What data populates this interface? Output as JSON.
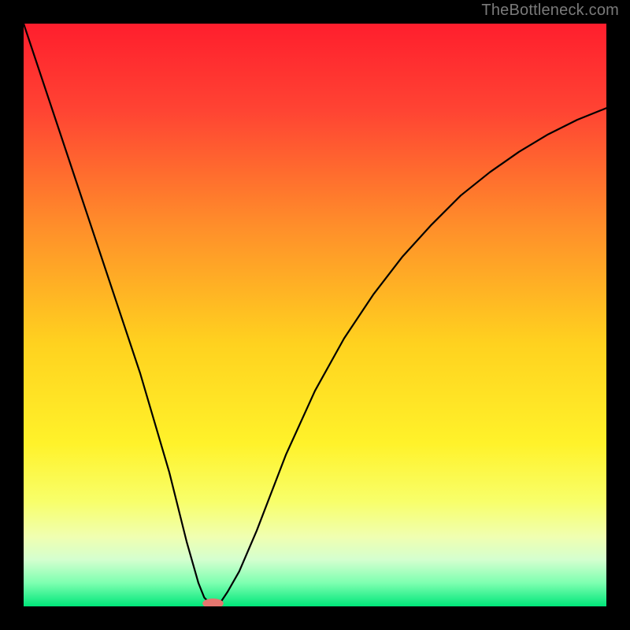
{
  "watermark": "TheBottleneck.com",
  "chart_data": {
    "type": "line",
    "title": "",
    "xlabel": "",
    "ylabel": "",
    "xlim": [
      0,
      100
    ],
    "ylim": [
      0,
      100
    ],
    "grid": false,
    "legend": false,
    "series": [
      {
        "name": "bottleneck-curve",
        "x": [
          0,
          5,
          10,
          15,
          20,
          25,
          28,
          30,
          31,
          32,
          33,
          34,
          35,
          37,
          40,
          45,
          50,
          55,
          60,
          65,
          70,
          75,
          80,
          85,
          90,
          95,
          100
        ],
        "y": [
          100,
          85,
          70,
          55,
          40,
          23,
          11,
          4,
          1.5,
          0.5,
          0.5,
          1,
          2.5,
          6,
          13,
          26,
          37,
          46,
          53.5,
          60,
          65.5,
          70.5,
          74.5,
          78,
          81,
          83.5,
          85.5
        ]
      }
    ],
    "gradient_stops": [
      {
        "offset": 0.0,
        "color": "#ff1e2d"
      },
      {
        "offset": 0.15,
        "color": "#ff4433"
      },
      {
        "offset": 0.35,
        "color": "#ff8f2a"
      },
      {
        "offset": 0.55,
        "color": "#ffd21f"
      },
      {
        "offset": 0.72,
        "color": "#fff22a"
      },
      {
        "offset": 0.82,
        "color": "#f8ff6a"
      },
      {
        "offset": 0.88,
        "color": "#f0ffb0"
      },
      {
        "offset": 0.92,
        "color": "#d4ffcf"
      },
      {
        "offset": 0.96,
        "color": "#7dffb0"
      },
      {
        "offset": 1.0,
        "color": "#00e67a"
      }
    ],
    "marker": {
      "x": 32.5,
      "y": 0.5,
      "rx": 1.8,
      "ry": 0.85,
      "color": "#e5766f"
    }
  }
}
